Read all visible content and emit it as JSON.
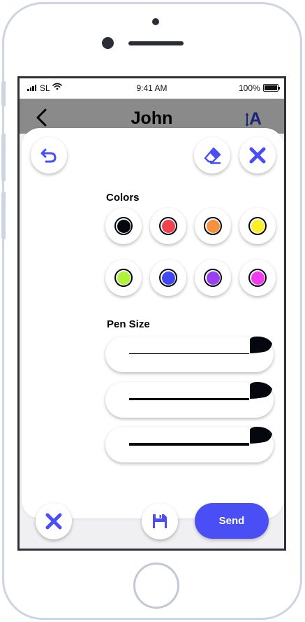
{
  "status_bar": {
    "carrier": "SL",
    "time": "9:41 AM",
    "battery": "100%"
  },
  "nav_bar": {
    "title": "John",
    "back_icon": "chevron-left-icon",
    "text_size_icon": "text-size-icon",
    "text_size_glyph": "A"
  },
  "toolbar": {
    "undo_icon": "undo-icon",
    "eraser_icon": "eraser-icon",
    "close_icon": "close-icon"
  },
  "colors": {
    "label": "Colors",
    "swatches": [
      {
        "name": "black",
        "hex": "#05070f"
      },
      {
        "name": "red",
        "hex": "#f0424f"
      },
      {
        "name": "orange",
        "hex": "#f7913d"
      },
      {
        "name": "yellow",
        "hex": "#fbef2c"
      },
      {
        "name": "green",
        "hex": "#aef23c"
      },
      {
        "name": "blue",
        "hex": "#4047f5"
      },
      {
        "name": "purple",
        "hex": "#9a3ff0"
      },
      {
        "name": "magenta",
        "hex": "#f03bf0"
      }
    ]
  },
  "pen_size": {
    "label": "Pen Size",
    "options": [
      {
        "name": "thin"
      },
      {
        "name": "medium"
      },
      {
        "name": "thick"
      }
    ]
  },
  "bottom_bar": {
    "cancel_icon": "close-icon",
    "save_icon": "floppy-disk-icon",
    "send_label": "Send"
  },
  "theme": {
    "accent": "#4a4ff5",
    "ink": "#05070f",
    "nav_background": "#8a8a8a"
  }
}
